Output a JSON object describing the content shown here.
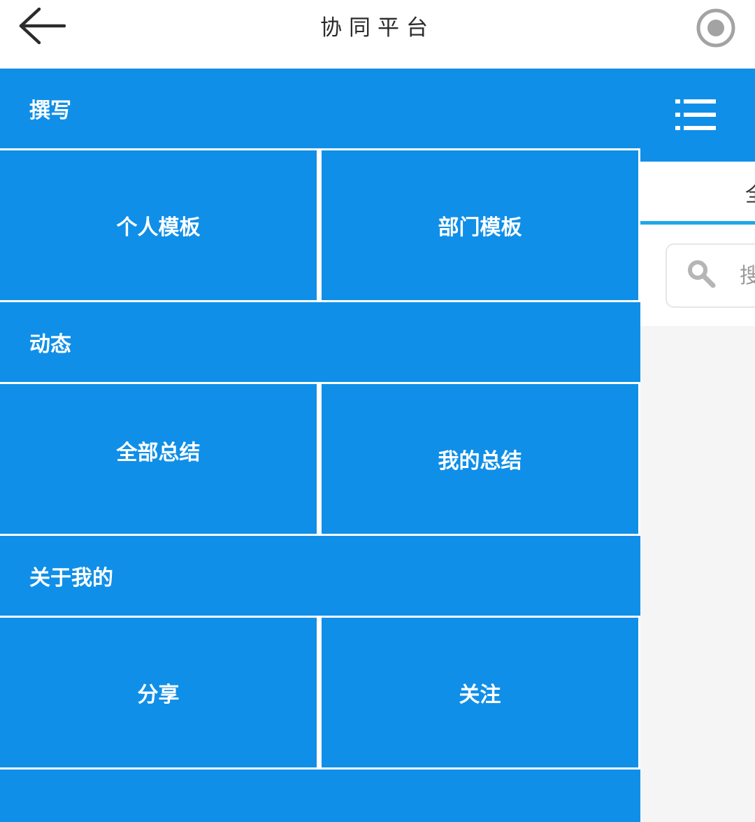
{
  "topbar": {
    "title": "协同平台",
    "back_icon": "arrow-left-icon",
    "record_icon": "record-icon"
  },
  "right_panel": {
    "menu_icon": "list-menu-icon",
    "tab_label": "全",
    "search_placeholder": "搜",
    "search_icon": "search-icon",
    "colors": {
      "header": "#0f8fe8",
      "tab_underline": "#1ea7e8",
      "background": "#f5f5f5"
    }
  },
  "drawer": {
    "accent": "#0f8fe8",
    "sections": [
      {
        "title": "撰写",
        "items": [
          "个人模板",
          "部门模板"
        ]
      },
      {
        "title": "动态",
        "items": [
          "全部总结",
          "我的总结"
        ]
      },
      {
        "title": "关于我的",
        "items": [
          "分享",
          "关注"
        ]
      }
    ]
  }
}
